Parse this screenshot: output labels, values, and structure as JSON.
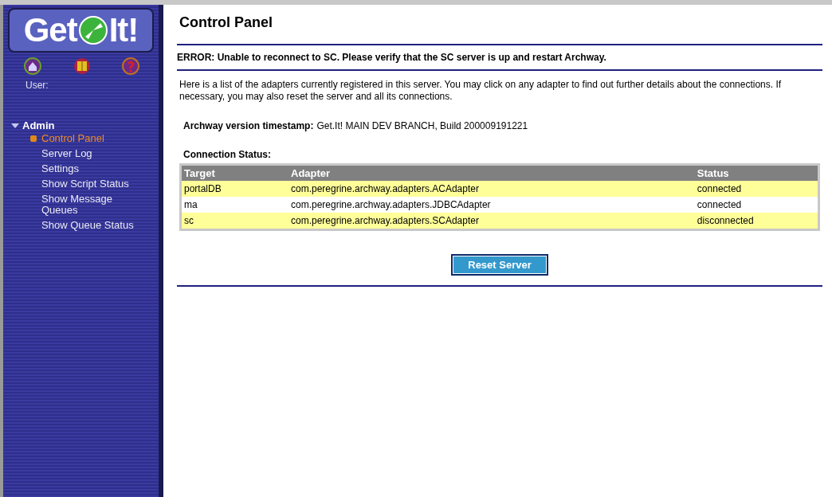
{
  "sidebar": {
    "logo": {
      "left": "Get",
      "right": "It!"
    },
    "user_label": "User:",
    "section": {
      "label": "Admin",
      "expanded": true,
      "items": [
        {
          "label": "Control Panel",
          "selected": true
        },
        {
          "label": "Server Log",
          "selected": false
        },
        {
          "label": "Settings",
          "selected": false
        },
        {
          "label": "Show Script Status",
          "selected": false
        },
        {
          "label": "Show Message Queues",
          "selected": false
        },
        {
          "label": "Show Queue Status",
          "selected": false
        }
      ]
    }
  },
  "main": {
    "title": "Control Panel",
    "error": "ERROR: Unable to reconnect to SC. Please verify that the SC server is up and restart Archway.",
    "intro": "Here is a list of the adapters currently registered in this server. You may click on any adapter to find out further details about the connections. If necessary, you may also reset the server and all its connections.",
    "version_label": "Archway version timestamp:",
    "version_value": "Get.It! MAIN DEV BRANCH, Build 200009191221",
    "table_title": "Connection Status:",
    "columns": [
      "Target",
      "Adapter",
      "Status"
    ],
    "rows": [
      [
        "portalDB",
        "com.peregrine.archway.adapters.ACAdapter",
        "connected"
      ],
      [
        "ma",
        "com.peregrine.archway.adapters.JDBCAdapter",
        "connected"
      ],
      [
        "sc",
        "com.peregrine.archway.adapters.SCAdapter",
        "disconnected"
      ]
    ],
    "reset_button": "Reset Server"
  }
}
